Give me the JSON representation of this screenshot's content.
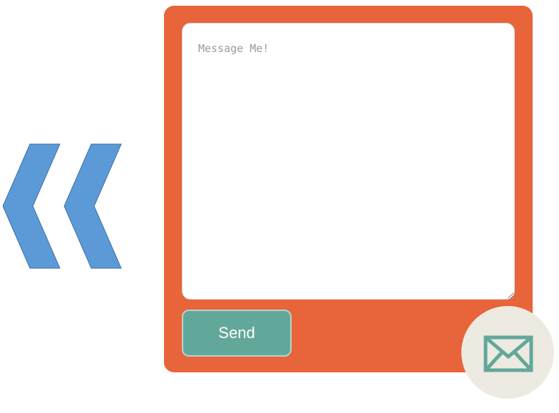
{
  "message_form": {
    "textarea_placeholder": "Message Me!",
    "textarea_value": "",
    "send_label": "Send"
  },
  "icons": {
    "collapse": "double-chevron-left-icon",
    "mail": "envelope-icon"
  },
  "colors": {
    "panel_background": "#e8643a",
    "send_button": "#62a89a",
    "chevron": "#5b9ad7",
    "mail_circle": "#edeae1",
    "mail_icon": "#62a89a"
  }
}
